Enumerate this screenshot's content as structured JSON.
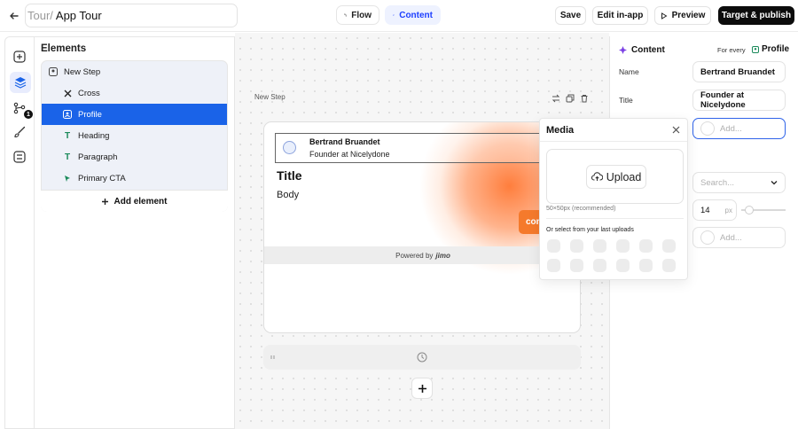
{
  "header": {
    "title_prefix": "Tour/",
    "title": "App Tour",
    "tabs": [
      {
        "label": "Flow",
        "icon": "flow-icon",
        "active": false
      },
      {
        "label": "Content",
        "icon": "content-icon",
        "active": true
      }
    ],
    "buttons": {
      "save": "Save",
      "edit_in_app": "Edit in-app",
      "preview": "Preview",
      "target_publish": "Target & publish"
    }
  },
  "rail": {
    "badge": "1"
  },
  "elements_panel": {
    "title": "Elements",
    "items": [
      {
        "label": "New Step",
        "icon": "step-icon",
        "selected": false
      },
      {
        "label": "Cross",
        "icon": "cross-icon",
        "selected": false
      },
      {
        "label": "Profile",
        "icon": "profile-icon",
        "selected": true
      },
      {
        "label": "Heading",
        "icon": "text-icon",
        "selected": false
      },
      {
        "label": "Paragraph",
        "icon": "text-icon",
        "selected": false
      },
      {
        "label": "Primary CTA",
        "icon": "cta-icon",
        "selected": false
      }
    ],
    "add_label": "Add element"
  },
  "canvas": {
    "step_label": "New Step",
    "profile_name": "Bertrand Bruandet",
    "profile_role": "Founder at Nicelydone",
    "title": "Title",
    "body": "Body",
    "cta_text": "con",
    "powered_by": "Powered by",
    "brand": "jimo",
    "brand_color": "#f57a2c"
  },
  "right_panel": {
    "section": "Content",
    "for_every": "For every",
    "scope": "Profile",
    "name_label": "Name",
    "name_value": "Bertrand Bruandet",
    "title_label": "Title",
    "title_value": "Founder at Nicelydone",
    "add_placeholder": "Add...",
    "search_placeholder": "Search...",
    "size_value": "14",
    "size_unit": "px",
    "add_placeholder_2": "Add..."
  },
  "media_popover": {
    "title": "Media",
    "upload_label": "Upload",
    "recommend": "50×50px (recommended)",
    "recent_label": "Or select from your last uploads"
  },
  "colors": {
    "accent": "#1a63e8",
    "publish_bg": "#0c0c0c"
  }
}
